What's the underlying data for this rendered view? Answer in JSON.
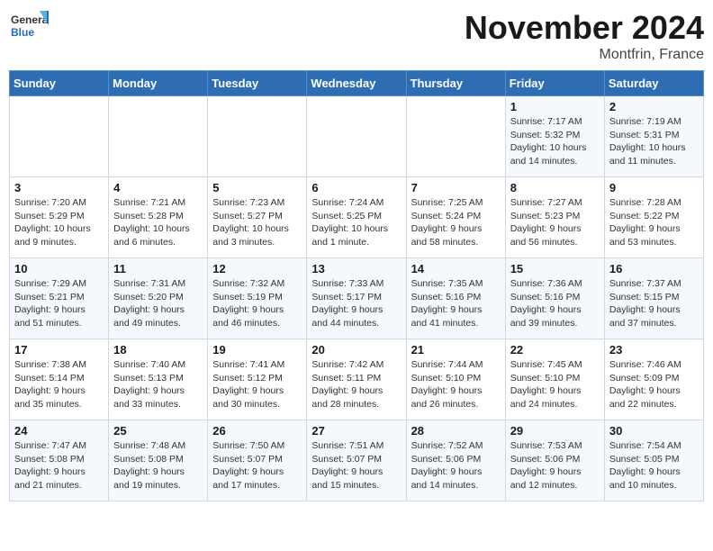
{
  "logo": {
    "line1": "General",
    "line2": "Blue"
  },
  "title": "November 2024",
  "location": "Montfrin, France",
  "weekdays": [
    "Sunday",
    "Monday",
    "Tuesday",
    "Wednesday",
    "Thursday",
    "Friday",
    "Saturday"
  ],
  "weeks": [
    [
      {
        "day": "",
        "info": ""
      },
      {
        "day": "",
        "info": ""
      },
      {
        "day": "",
        "info": ""
      },
      {
        "day": "",
        "info": ""
      },
      {
        "day": "",
        "info": ""
      },
      {
        "day": "1",
        "info": "Sunrise: 7:17 AM\nSunset: 5:32 PM\nDaylight: 10 hours and 14 minutes."
      },
      {
        "day": "2",
        "info": "Sunrise: 7:19 AM\nSunset: 5:31 PM\nDaylight: 10 hours and 11 minutes."
      }
    ],
    [
      {
        "day": "3",
        "info": "Sunrise: 7:20 AM\nSunset: 5:29 PM\nDaylight: 10 hours and 9 minutes."
      },
      {
        "day": "4",
        "info": "Sunrise: 7:21 AM\nSunset: 5:28 PM\nDaylight: 10 hours and 6 minutes."
      },
      {
        "day": "5",
        "info": "Sunrise: 7:23 AM\nSunset: 5:27 PM\nDaylight: 10 hours and 3 minutes."
      },
      {
        "day": "6",
        "info": "Sunrise: 7:24 AM\nSunset: 5:25 PM\nDaylight: 10 hours and 1 minute."
      },
      {
        "day": "7",
        "info": "Sunrise: 7:25 AM\nSunset: 5:24 PM\nDaylight: 9 hours and 58 minutes."
      },
      {
        "day": "8",
        "info": "Sunrise: 7:27 AM\nSunset: 5:23 PM\nDaylight: 9 hours and 56 minutes."
      },
      {
        "day": "9",
        "info": "Sunrise: 7:28 AM\nSunset: 5:22 PM\nDaylight: 9 hours and 53 minutes."
      }
    ],
    [
      {
        "day": "10",
        "info": "Sunrise: 7:29 AM\nSunset: 5:21 PM\nDaylight: 9 hours and 51 minutes."
      },
      {
        "day": "11",
        "info": "Sunrise: 7:31 AM\nSunset: 5:20 PM\nDaylight: 9 hours and 49 minutes."
      },
      {
        "day": "12",
        "info": "Sunrise: 7:32 AM\nSunset: 5:19 PM\nDaylight: 9 hours and 46 minutes."
      },
      {
        "day": "13",
        "info": "Sunrise: 7:33 AM\nSunset: 5:17 PM\nDaylight: 9 hours and 44 minutes."
      },
      {
        "day": "14",
        "info": "Sunrise: 7:35 AM\nSunset: 5:16 PM\nDaylight: 9 hours and 41 minutes."
      },
      {
        "day": "15",
        "info": "Sunrise: 7:36 AM\nSunset: 5:16 PM\nDaylight: 9 hours and 39 minutes."
      },
      {
        "day": "16",
        "info": "Sunrise: 7:37 AM\nSunset: 5:15 PM\nDaylight: 9 hours and 37 minutes."
      }
    ],
    [
      {
        "day": "17",
        "info": "Sunrise: 7:38 AM\nSunset: 5:14 PM\nDaylight: 9 hours and 35 minutes."
      },
      {
        "day": "18",
        "info": "Sunrise: 7:40 AM\nSunset: 5:13 PM\nDaylight: 9 hours and 33 minutes."
      },
      {
        "day": "19",
        "info": "Sunrise: 7:41 AM\nSunset: 5:12 PM\nDaylight: 9 hours and 30 minutes."
      },
      {
        "day": "20",
        "info": "Sunrise: 7:42 AM\nSunset: 5:11 PM\nDaylight: 9 hours and 28 minutes."
      },
      {
        "day": "21",
        "info": "Sunrise: 7:44 AM\nSunset: 5:10 PM\nDaylight: 9 hours and 26 minutes."
      },
      {
        "day": "22",
        "info": "Sunrise: 7:45 AM\nSunset: 5:10 PM\nDaylight: 9 hours and 24 minutes."
      },
      {
        "day": "23",
        "info": "Sunrise: 7:46 AM\nSunset: 5:09 PM\nDaylight: 9 hours and 22 minutes."
      }
    ],
    [
      {
        "day": "24",
        "info": "Sunrise: 7:47 AM\nSunset: 5:08 PM\nDaylight: 9 hours and 21 minutes."
      },
      {
        "day": "25",
        "info": "Sunrise: 7:48 AM\nSunset: 5:08 PM\nDaylight: 9 hours and 19 minutes."
      },
      {
        "day": "26",
        "info": "Sunrise: 7:50 AM\nSunset: 5:07 PM\nDaylight: 9 hours and 17 minutes."
      },
      {
        "day": "27",
        "info": "Sunrise: 7:51 AM\nSunset: 5:07 PM\nDaylight: 9 hours and 15 minutes."
      },
      {
        "day": "28",
        "info": "Sunrise: 7:52 AM\nSunset: 5:06 PM\nDaylight: 9 hours and 14 minutes."
      },
      {
        "day": "29",
        "info": "Sunrise: 7:53 AM\nSunset: 5:06 PM\nDaylight: 9 hours and 12 minutes."
      },
      {
        "day": "30",
        "info": "Sunrise: 7:54 AM\nSunset: 5:05 PM\nDaylight: 9 hours and 10 minutes."
      }
    ]
  ]
}
